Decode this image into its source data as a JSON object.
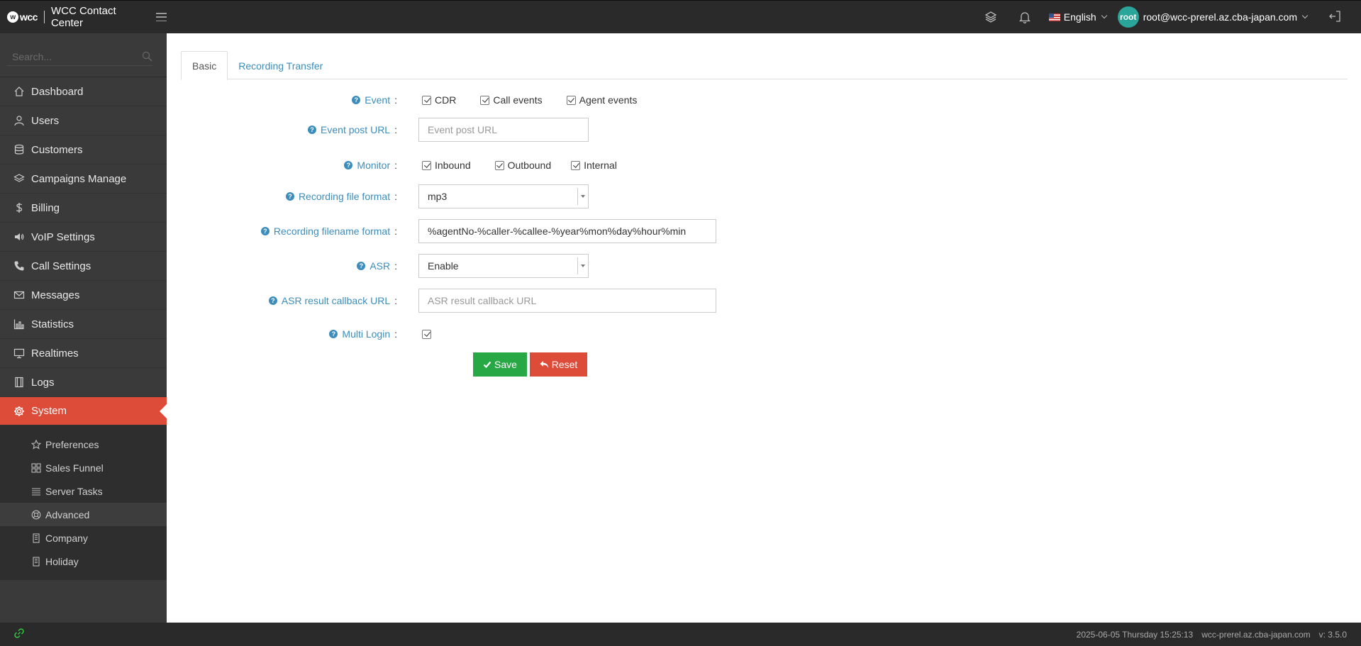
{
  "header": {
    "logo_text": "wcc",
    "app_title": "WCC Contact Center",
    "language": "English",
    "avatar_text": "root",
    "user_email": "root@wcc-prerel.az.cba-japan.com"
  },
  "sidebar": {
    "search_placeholder": "Search...",
    "items": [
      {
        "label": "Dashboard",
        "icon": "home-icon"
      },
      {
        "label": "Users",
        "icon": "user-icon"
      },
      {
        "label": "Customers",
        "icon": "database-icon"
      },
      {
        "label": "Campaigns Manage",
        "icon": "layers-icon"
      },
      {
        "label": "Billing",
        "icon": "dollar-icon"
      },
      {
        "label": "VoIP Settings",
        "icon": "volume-icon"
      },
      {
        "label": "Call Settings",
        "icon": "phone-icon"
      },
      {
        "label": "Messages",
        "icon": "envelope-icon"
      },
      {
        "label": "Statistics",
        "icon": "bar-chart-icon"
      },
      {
        "label": "Realtimes",
        "icon": "monitor-icon"
      },
      {
        "label": "Logs",
        "icon": "film-icon"
      },
      {
        "label": "System",
        "icon": "gear-icon"
      }
    ],
    "sub_items": [
      {
        "label": "Preferences",
        "icon": "star-icon"
      },
      {
        "label": "Sales Funnel",
        "icon": "grid-icon"
      },
      {
        "label": "Server Tasks",
        "icon": "tasks-icon"
      },
      {
        "label": "Advanced",
        "icon": "lifebuoy-icon"
      },
      {
        "label": "Company",
        "icon": "building-icon"
      },
      {
        "label": "Holiday",
        "icon": "building-icon"
      }
    ]
  },
  "tabs": [
    "Basic",
    "Recording Transfer"
  ],
  "form": {
    "event": {
      "label": "Event",
      "options": [
        {
          "label": "CDR",
          "checked": true
        },
        {
          "label": "Call events",
          "checked": true
        },
        {
          "label": "Agent events",
          "checked": true
        }
      ]
    },
    "event_post_url": {
      "label": "Event post URL",
      "value": "",
      "placeholder": "Event post URL"
    },
    "monitor": {
      "label": "Monitor",
      "options": [
        {
          "label": "Inbound",
          "checked": true
        },
        {
          "label": "Outbound",
          "checked": true
        },
        {
          "label": "Internal",
          "checked": true
        }
      ]
    },
    "recording_file_format": {
      "label": "Recording file format",
      "value": "mp3"
    },
    "recording_filename_format": {
      "label": "Recording filename format",
      "value": "%agentNo-%caller-%callee-%year%mon%day%hour%min"
    },
    "asr": {
      "label": "ASR",
      "value": "Enable"
    },
    "asr_callback_url": {
      "label": "ASR result callback URL",
      "value": "",
      "placeholder": "ASR result callback URL"
    },
    "multi_login": {
      "label": "Multi Login",
      "checked": true
    },
    "colon": ":",
    "help_glyph": "?",
    "save_label": "Save",
    "reset_label": "Reset"
  },
  "footer": {
    "datetime": "2025-06-05 Thursday 15:25:13",
    "host": "wcc-prerel.az.cba-japan.com",
    "version": "v: 3.5.0"
  },
  "colors": {
    "accent_blue": "#3c8dbc",
    "active_red": "#dd4b39",
    "save_green": "#28a745",
    "sidebar_bg": "#3a3a3a",
    "topbar_bg": "#2a2a2a",
    "avatar_teal": "#2aa59a"
  }
}
